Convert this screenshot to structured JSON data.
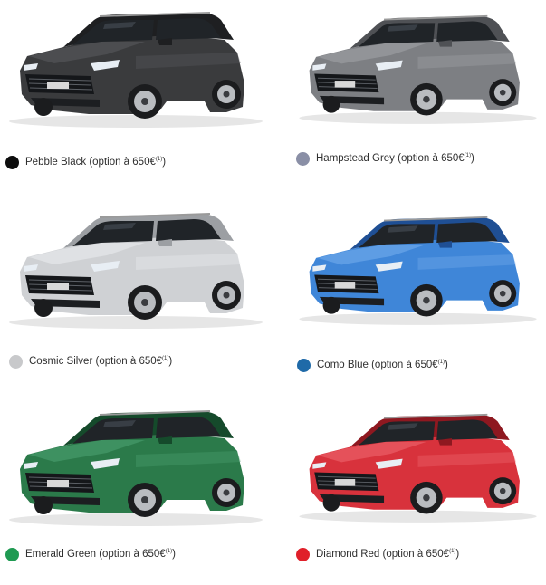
{
  "colors": [
    {
      "id": "pebble-black",
      "name": "Pebble Black",
      "option": "(option à 650€",
      "note": "(1)",
      "swatch": "#0d0d0d",
      "body": "#3a3b3d",
      "shade": "#1e1f21",
      "hi": "#5b5d60",
      "icon": "car-image"
    },
    {
      "id": "hampstead-grey",
      "name": "Hampstead Grey",
      "option": "(option à 650€",
      "note": "(1)",
      "swatch": "#8a8fa6",
      "body": "#7d7f83",
      "shade": "#4f5155",
      "hi": "#a4a6aa",
      "icon": "car-image"
    },
    {
      "id": "cosmic-silver",
      "name": "Cosmic Silver",
      "option": "(option à 650€",
      "note": "(1)",
      "swatch": "#c8c9cb",
      "body": "#cfd1d4",
      "shade": "#9c9fa3",
      "hi": "#eceef0",
      "icon": "car-image"
    },
    {
      "id": "como-blue",
      "name": "Como Blue",
      "option": "(option à 650€",
      "note": "(1)",
      "swatch": "#1f6aa8",
      "body": "#3f86d8",
      "shade": "#1f4f94",
      "hi": "#79b0ef",
      "icon": "car-image"
    },
    {
      "id": "emerald-green",
      "name": "Emerald Green",
      "option": "(option à 650€",
      "note": "(1)",
      "swatch": "#1f9a52",
      "body": "#2b7a4a",
      "shade": "#154a2b",
      "hi": "#4ea474",
      "icon": "car-image"
    },
    {
      "id": "diamond-red",
      "name": "Diamond Red",
      "option": "(option à 650€",
      "note": "(1)",
      "swatch": "#e0202a",
      "body": "#d8323c",
      "shade": "#8e1820",
      "hi": "#f06c72",
      "icon": "car-image"
    }
  ],
  "closing": ")"
}
